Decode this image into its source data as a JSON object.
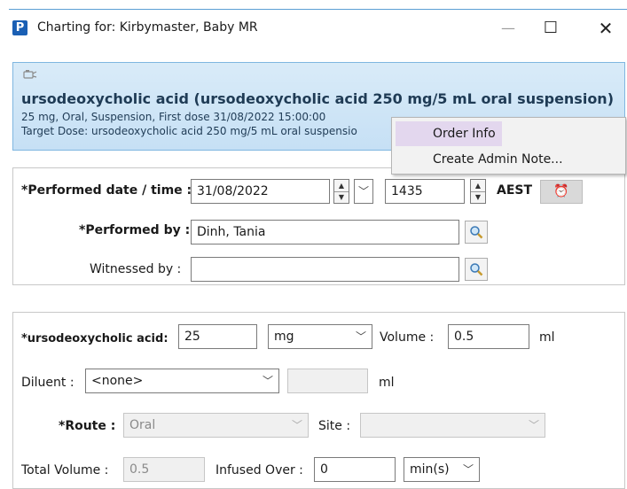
{
  "window": {
    "app_icon_letter": "P",
    "title": "Charting for: Kirbymaster, Baby  MR",
    "min_glyph": "—",
    "max_glyph": "☐",
    "close_glyph": "✕"
  },
  "order": {
    "icon": "bottle-icon",
    "drug_title": "ursodeoxycholic acid (ursodeoxycholic acid 250 mg/5 mL oral suspension)",
    "detail_line": "25 mg, Oral, Suspension, First dose 31/08/2022 15:00:00",
    "target_line": "Target Dose: ursodeoxycholic acid 250 mg/5 mL oral suspensio"
  },
  "context_menu": {
    "items": [
      "Order Info",
      "Create Admin Note..."
    ],
    "highlighted": 0
  },
  "performed": {
    "date_label": "*Performed date / time :",
    "date_value": "31/08/2022",
    "time_value": "1435",
    "timezone": "AEST",
    "by_label": "*Performed by :",
    "by_value": "Dinh, Tania",
    "witness_label": "Witnessed by :",
    "witness_value": ""
  },
  "dose": {
    "drug_label": "*ursodeoxycholic acid:",
    "dose_value": "25",
    "unit_value": "mg",
    "volume_label": "Volume :",
    "volume_value": "0.5",
    "volume_unit": "ml",
    "diluent_label": "Diluent :",
    "diluent_value": "<none>",
    "diluent_unit": "ml",
    "route_label": "*Route :",
    "route_value": "Oral",
    "site_label": "Site :",
    "site_value": "",
    "total_volume_label": "Total Volume :",
    "total_volume_value": "0.5",
    "infused_over_label": "Infused Over :",
    "infused_over_value": "0",
    "infused_unit_value": "min(s)"
  },
  "colors": {
    "banner_blue": "#c6e0f5",
    "menu_highlight": "#e3d7ee",
    "title_text": "#1f3b55"
  }
}
